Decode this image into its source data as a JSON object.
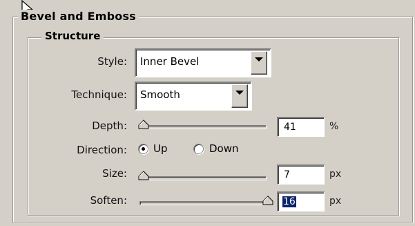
{
  "panel": {
    "title": "Bevel and Emboss",
    "section": "Structure"
  },
  "fields": {
    "style": {
      "label": "Style:",
      "value": "Inner Bevel"
    },
    "technique": {
      "label": "Technique:",
      "value": "Smooth"
    },
    "depth": {
      "label": "Depth:",
      "value": "41",
      "unit": "%",
      "slider_fraction": 0.0
    },
    "direction": {
      "label": "Direction:",
      "options": [
        "Up",
        "Down"
      ],
      "selected": "Up"
    },
    "size": {
      "label": "Size:",
      "value": "7",
      "unit": "px",
      "slider_fraction": 0.0
    },
    "soften": {
      "label": "Soften:",
      "value": "16",
      "unit": "px",
      "slider_fraction": 1.0
    }
  },
  "icons": {
    "cursor": "mouse-pointer-icon",
    "dropdown": "chevron-down-icon",
    "slider_thumb": "slider-thumb-icon"
  },
  "colors": {
    "face": "#d4d0c8",
    "selection": "#0a246a"
  }
}
